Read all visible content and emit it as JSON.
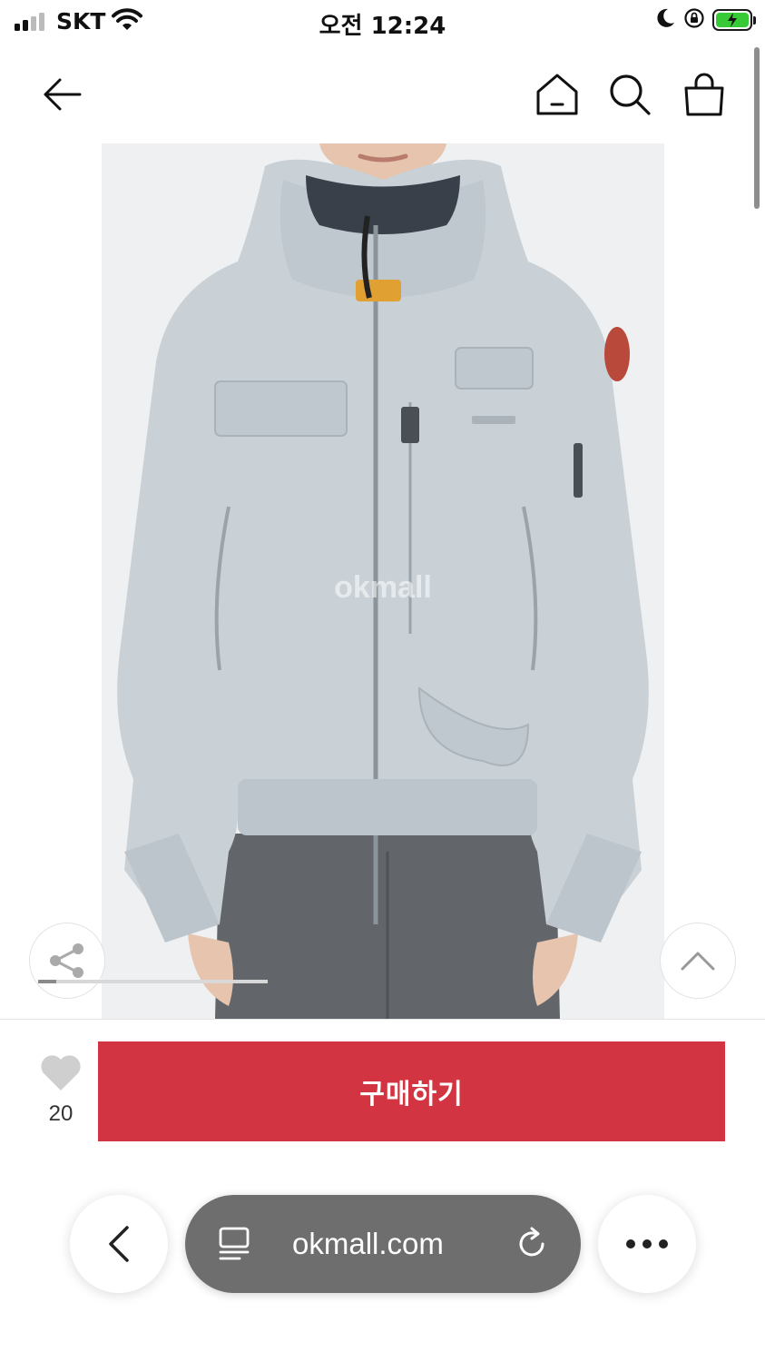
{
  "status_bar": {
    "carrier": "SKT",
    "time": "오전 12:24",
    "battery_color": "#37c936"
  },
  "nav": {
    "back_icon": "arrow-left-icon",
    "home_icon": "home-icon",
    "search_icon": "search-icon",
    "cart_icon": "shopping-bag-icon"
  },
  "product": {
    "image_description_icon": "jacket-photo",
    "watermark": "okmall",
    "jacket_color": "#c9d1d7",
    "image_progress": 0.08
  },
  "floating": {
    "share_icon": "share-icon",
    "top_icon": "chevron-up-icon"
  },
  "purchase": {
    "like_count": "20",
    "buy_label": "구매하기",
    "buy_color": "#d23541"
  },
  "browser": {
    "url": "okmall.com",
    "back_icon": "chevron-left-icon",
    "tabs_icon": "reader-icon",
    "reload_icon": "reload-icon",
    "more_icon": "more-icon"
  }
}
